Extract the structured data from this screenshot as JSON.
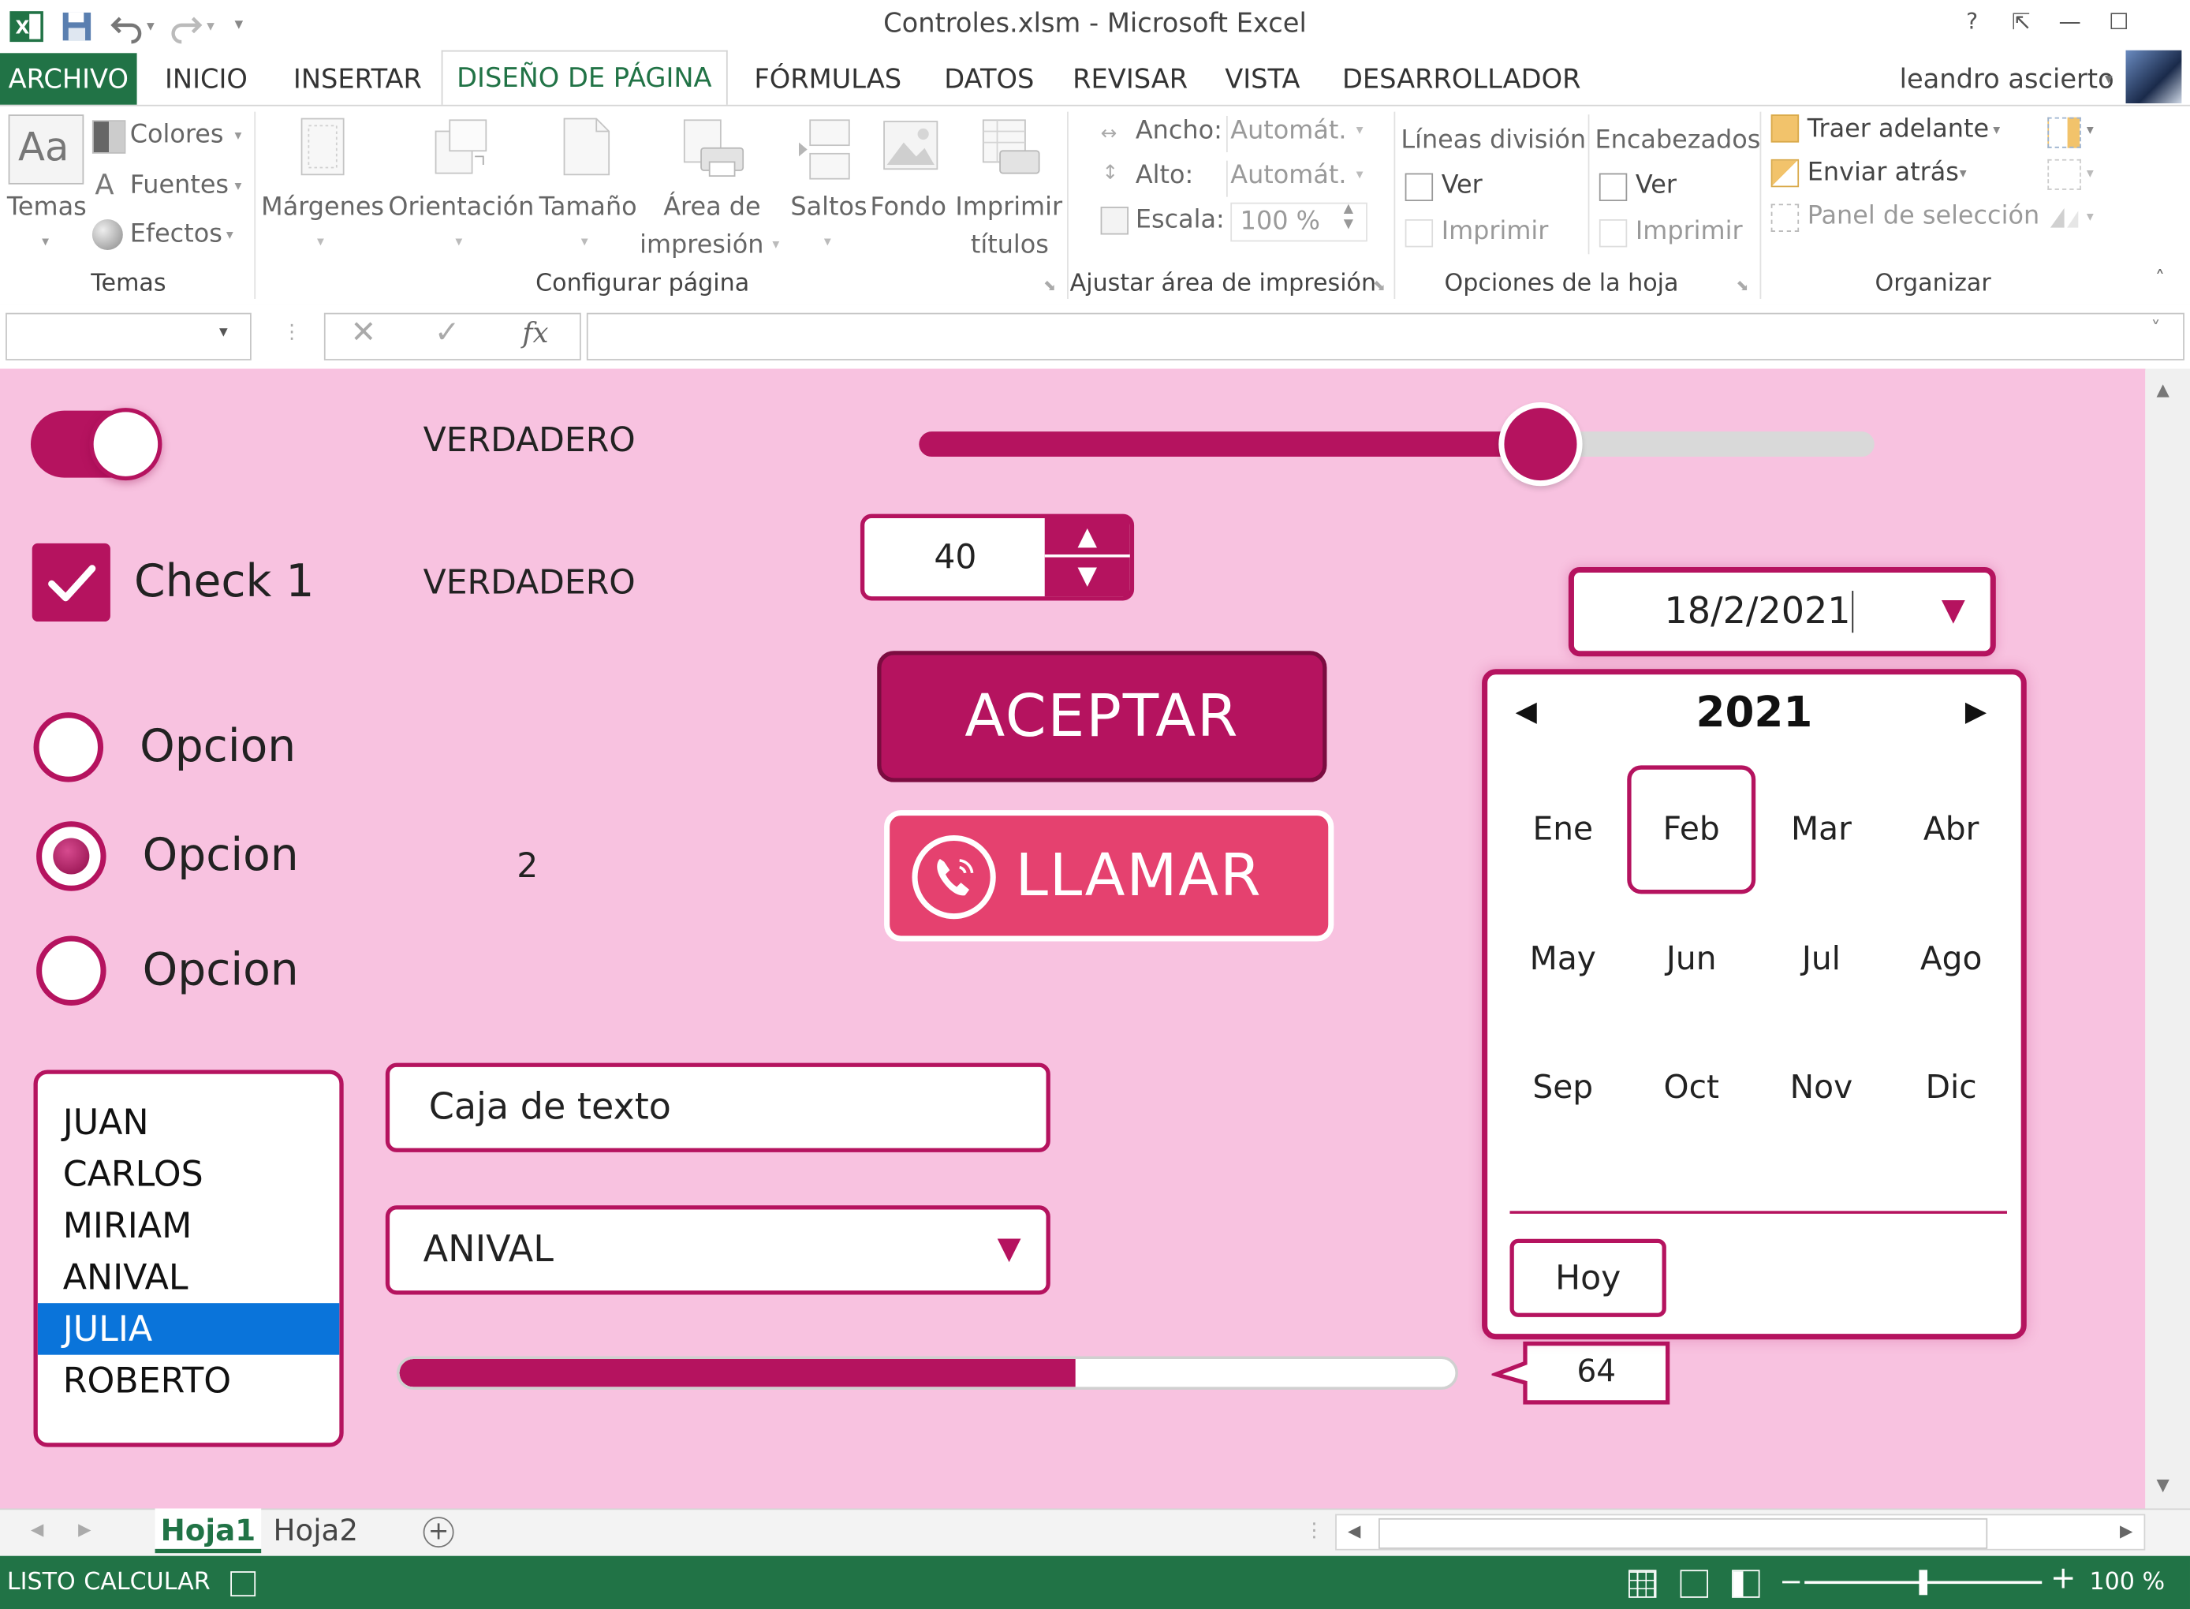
{
  "window": {
    "title": "Controles.xlsm - Microsoft Excel",
    "controls": [
      "?",
      "⇱",
      "—",
      "☐"
    ]
  },
  "tabs": {
    "file": "ARCHIVO",
    "items": [
      "INICIO",
      "INSERTAR",
      "DISEÑO DE PÁGINA",
      "FÓRMULAS",
      "DATOS",
      "REVISAR",
      "VISTA",
      "DESARROLLADOR"
    ],
    "active": "DISEÑO DE PÁGINA"
  },
  "user": {
    "name": "leandro ascierto"
  },
  "ribbon": {
    "temas": {
      "button": "Temas",
      "colores": "Colores",
      "fuentes": "Fuentes",
      "efectos": "Efectos",
      "group": "Temas",
      "icon_text": "Aa"
    },
    "configurar": {
      "margenes": "Márgenes",
      "orientacion": "Orientación",
      "tamano": "Tamaño",
      "area_1": "Área de",
      "area_2": "impresión",
      "saltos": "Saltos",
      "fondo": "Fondo",
      "imprimir_1": "Imprimir",
      "imprimir_2": "títulos",
      "group": "Configurar página"
    },
    "ajustar": {
      "ancho_label": "Ancho:",
      "ancho_value": "Automát.",
      "alto_label": "Alto:",
      "alto_value": "Automát.",
      "escala_label": "Escala:",
      "escala_value": "100 %",
      "group": "Ajustar área de impresión"
    },
    "opciones": {
      "lineas": "Líneas división",
      "encabezados": "Encabezados",
      "ver1": "Ver",
      "imprimir1": "Imprimir",
      "ver2": "Ver",
      "imprimir2": "Imprimir",
      "group": "Opciones de la hoja"
    },
    "organizar": {
      "traer": "Traer adelante",
      "enviar": "Enviar atrás",
      "panel": "Panel de selección",
      "group": "Organizar"
    }
  },
  "formula_bar": {
    "name_box": "",
    "fx": "fx",
    "content": ""
  },
  "sheet": {
    "toggle_value": "VERDADERO",
    "checkbox_label": "Check 1",
    "checkbox_value": "VERDADERO",
    "radio_labels": [
      "Opcion",
      "Opcion",
      "Opcion"
    ],
    "radio_selected_index": 1,
    "radio_value": "2",
    "slider_fraction": 0.65,
    "spinner_value": "40",
    "accept_button": "ACEPTAR",
    "call_button": "LLAMAR",
    "date_value": "18/2/2021",
    "calendar": {
      "year": "2021",
      "months": [
        "Ene",
        "Feb",
        "Mar",
        "Abr",
        "May",
        "Jun",
        "Jul",
        "Ago",
        "Sep",
        "Oct",
        "Nov",
        "Dic"
      ],
      "selected_month": "Feb",
      "today_button": "Hoy"
    },
    "list_items": [
      "JUAN",
      "CARLOS",
      "MIRIAM",
      "ANIVAL",
      "JULIA",
      "ROBERTO"
    ],
    "list_selected": "JULIA",
    "textbox_value": "Caja de texto",
    "combo_value": "ANIVAL",
    "progress_percent": 64,
    "progress_label": "64"
  },
  "sheet_tabs": {
    "items": [
      "Hoja1",
      "Hoja2"
    ],
    "active": "Hoja1"
  },
  "status": {
    "ready": "LISTO",
    "calc": "CALCULAR",
    "zoom": "100 %"
  },
  "colors": {
    "excel_green": "#217346",
    "accent": "#b5135f",
    "sheet_bg": "#f8c2e0",
    "call_button": "#e5416f",
    "list_select": "#0a74da"
  }
}
